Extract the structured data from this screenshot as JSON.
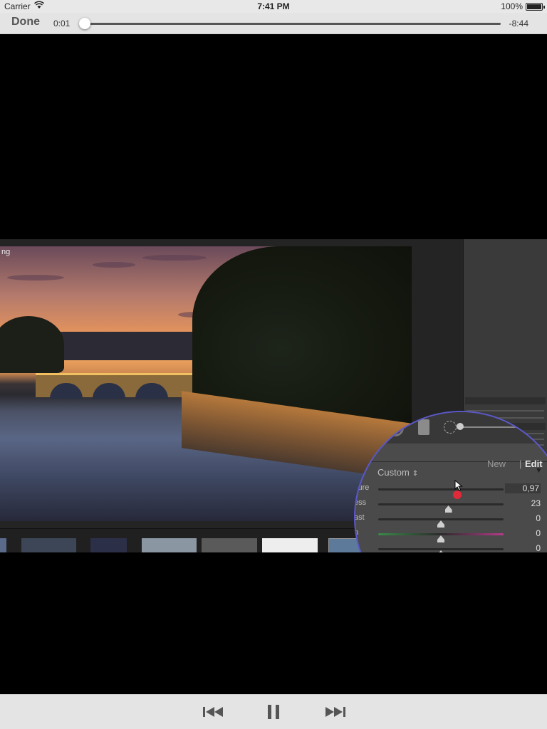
{
  "status_bar": {
    "carrier": "Carrier",
    "time": "7:41 PM",
    "battery": "100%",
    "battery_level": 1.0
  },
  "player": {
    "done_label": "Done",
    "elapsed": "0:01",
    "remaining": "-8:44",
    "progress": 0.002
  },
  "video": {
    "corner_text": "ng",
    "magnifier": {
      "tab_new": "New",
      "tab_separator": "|",
      "tab_edit": "Edit",
      "preset": "Custom",
      "sliders": [
        {
          "label": "sure",
          "value": "0,97",
          "position": 0.63
        },
        {
          "label": "ess",
          "value": "23",
          "position": 0.56
        },
        {
          "label": "ast",
          "value": "0",
          "position": 0.5
        },
        {
          "label": "n",
          "value": "0",
          "position": 0.5
        },
        {
          "label": "",
          "value": "0",
          "position": 0.5
        },
        {
          "label": "",
          "value": "",
          "position": 0.5
        }
      ]
    }
  },
  "icons": {
    "wifi": "wifi-icon",
    "prev": "skip-back-icon",
    "pause": "pause-icon",
    "next": "skip-forward-icon"
  },
  "colors": {
    "bar_bg": "#e4e4e4",
    "magnifier_border": "#5b58c8",
    "active_thumb": "#e02a3a"
  }
}
